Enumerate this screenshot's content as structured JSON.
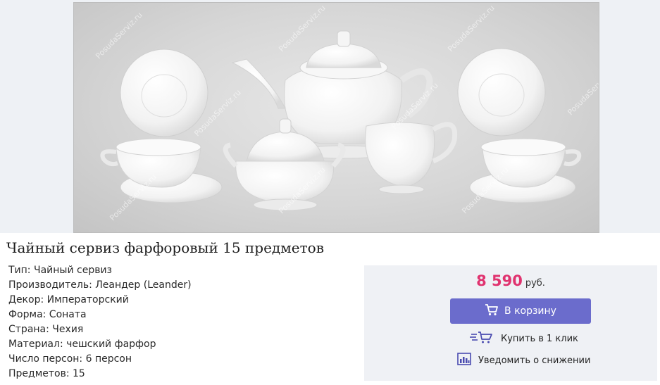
{
  "product": {
    "title": "Чайный сервиз фарфоровый 15 предметов",
    "image_watermark": "PosudaServiz.ru",
    "specs": [
      "Тип: Чайный сервиз",
      "Производитель: Леандер (Leander)",
      "Декор: Императорский",
      "Форма: Соната",
      "Страна: Чехия",
      "Материал: чешский фарфор",
      "Число персон: 6 персон",
      "Предметов: 15"
    ]
  },
  "purchase": {
    "price": "8 590",
    "currency": "руб.",
    "cart_button_label": "В корзину",
    "one_click_label": "Купить в 1 клик",
    "notify_label": "Уведомить о снижении"
  },
  "colors": {
    "accent": "#6b6ccc",
    "price": "#e0336f",
    "panel": "#eff1f5"
  },
  "icons": {
    "cart": "cart-icon",
    "fast_cart": "fast-cart-icon",
    "chart": "price-chart-icon"
  }
}
